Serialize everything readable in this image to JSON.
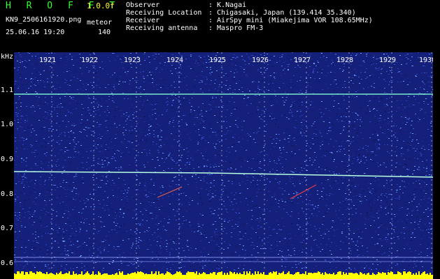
{
  "header": {
    "brand": "H R O F F T",
    "version": "1.0.0f",
    "filename": "KN9_2506161920.png",
    "meteor_label": "meteor",
    "datetime": "25.06.16 19:20",
    "meteor_count": "140",
    "fields": [
      {
        "label": "Observer",
        "value": ": K.Nagai"
      },
      {
        "label": "Receiving Location",
        "value": ": Chigasaki, Japan (139.414 35.340)"
      },
      {
        "label": "Receiver",
        "value": ": AirSpy mini (Miakejima VOR 108.65MHz)"
      },
      {
        "label": "Receiving antenna",
        "value": ": Maspro FM-3"
      }
    ]
  },
  "spectrogram": {
    "y_unit": "kHz",
    "y_ticks": [
      "1.1",
      "1.0",
      "0.9",
      "0.8",
      "0.7",
      "0.6"
    ],
    "x_ticks": [
      "1921",
      "1922",
      "1923",
      "1924",
      "1925",
      "1926",
      "1927",
      "1928",
      "1929",
      "1930"
    ],
    "colors": {
      "background": "#000000",
      "label_green": "#33ff33",
      "label_yellow": "#ffff33",
      "noise_base": "#1a2a8a",
      "carrier": "#7fffd4",
      "bottom_bar": "#ffff00"
    }
  }
}
